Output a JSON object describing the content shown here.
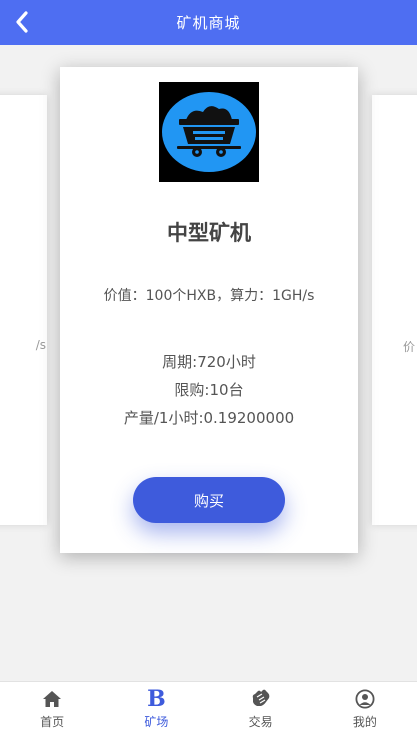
{
  "header": {
    "title": "矿机商城"
  },
  "carousel": {
    "left_peek_text": "/s",
    "right_peek_text": "价"
  },
  "card": {
    "name": "中型矿机",
    "price_line": "价值：100个HXB，算力：1GH/s",
    "period": "周期:720小时",
    "limit": "限购:10台",
    "output": "产量/1小时:0.19200000",
    "buy_label": "购买",
    "image_icon": "mine-cart-icon"
  },
  "tabbar": {
    "items": [
      {
        "label": "首页",
        "icon": "home-icon"
      },
      {
        "label": "矿场",
        "icon": "bold-b-icon",
        "active": true
      },
      {
        "label": "交易",
        "icon": "handshake-icon"
      },
      {
        "label": "我的",
        "icon": "user-icon"
      }
    ]
  },
  "colors": {
    "primary": "#4e6ef2",
    "button": "#3e5bdc",
    "mine_badge": "#2196f3"
  }
}
